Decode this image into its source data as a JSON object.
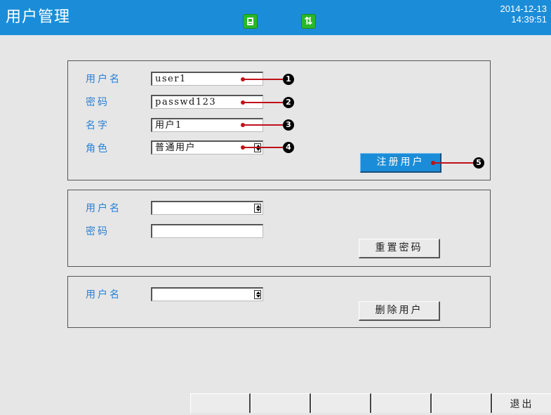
{
  "header": {
    "title": "用户管理",
    "date": "2014-12-13",
    "time": "14:39:51",
    "icons": [
      "save-icon",
      "sync-icon"
    ]
  },
  "register_panel": {
    "username_label": "用户名",
    "username_value": "user1",
    "password_label": "密码",
    "password_value": "passwd123",
    "name_label": "名字",
    "name_value": "用户1",
    "role_label": "角色",
    "role_value": "普通用户",
    "register_button": "注册用户",
    "markers": [
      "1",
      "2",
      "3",
      "4",
      "5"
    ]
  },
  "reset_panel": {
    "username_label": "用户名",
    "username_value": "",
    "password_label": "密码",
    "password_value": "",
    "reset_button": "重置密码"
  },
  "delete_panel": {
    "username_label": "用户名",
    "username_value": "",
    "delete_button": "删除用户"
  },
  "function_keys": [
    "",
    "",
    "",
    "",
    "",
    "退出"
  ],
  "colors": {
    "accent": "#1b8dd8",
    "label": "#2a7fd4",
    "callout": "#c0101a",
    "icon_green": "#28b828"
  }
}
